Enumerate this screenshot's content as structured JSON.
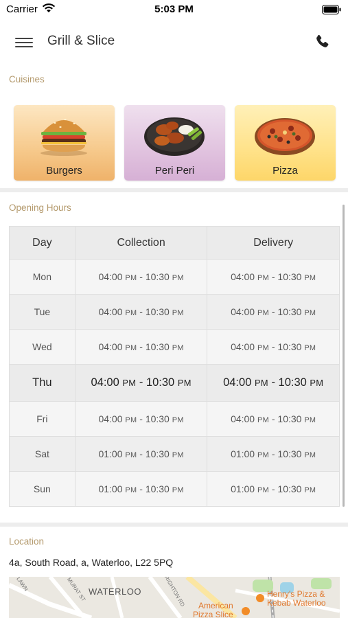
{
  "status_bar": {
    "carrier": "Carrier",
    "time": "5:03 PM"
  },
  "nav": {
    "title": "Grill & Slice",
    "menu_icon": "hamburger-menu-icon",
    "phone_icon": "phone-icon"
  },
  "cuisines": {
    "label": "Cuisines",
    "items": [
      {
        "name": "Burgers",
        "icon": "burger-image"
      },
      {
        "name": "Peri Peri",
        "icon": "chicken-wings-image"
      },
      {
        "name": "Pizza",
        "icon": "pizza-image"
      }
    ]
  },
  "opening_hours": {
    "label": "Opening Hours",
    "headers": [
      "Day",
      "Collection",
      "Delivery"
    ],
    "rows": [
      {
        "day": "Mon",
        "collection": {
          "open": "04:00",
          "open_ampm": "PM",
          "close": "10:30",
          "close_ampm": "PM"
        },
        "delivery": {
          "open": "04:00",
          "open_ampm": "PM",
          "close": "10:30",
          "close_ampm": "PM"
        }
      },
      {
        "day": "Tue",
        "collection": {
          "open": "04:00",
          "open_ampm": "PM",
          "close": "10:30",
          "close_ampm": "PM"
        },
        "delivery": {
          "open": "04:00",
          "open_ampm": "PM",
          "close": "10:30",
          "close_ampm": "PM"
        }
      },
      {
        "day": "Wed",
        "collection": {
          "open": "04:00",
          "open_ampm": "PM",
          "close": "10:30",
          "close_ampm": "PM"
        },
        "delivery": {
          "open": "04:00",
          "open_ampm": "PM",
          "close": "10:30",
          "close_ampm": "PM"
        }
      },
      {
        "day": "Thu",
        "collection": {
          "open": "04:00",
          "open_ampm": "PM",
          "close": "10:30",
          "close_ampm": "PM"
        },
        "delivery": {
          "open": "04:00",
          "open_ampm": "PM",
          "close": "10:30",
          "close_ampm": "PM"
        }
      },
      {
        "day": "Fri",
        "collection": {
          "open": "04:00",
          "open_ampm": "PM",
          "close": "10:30",
          "close_ampm": "PM"
        },
        "delivery": {
          "open": "04:00",
          "open_ampm": "PM",
          "close": "10:30",
          "close_ampm": "PM"
        }
      },
      {
        "day": "Sat",
        "collection": {
          "open": "01:00",
          "open_ampm": "PM",
          "close": "10:30",
          "close_ampm": "PM"
        },
        "delivery": {
          "open": "01:00",
          "open_ampm": "PM",
          "close": "10:30",
          "close_ampm": "PM"
        }
      },
      {
        "day": "Sun",
        "collection": {
          "open": "01:00",
          "open_ampm": "PM",
          "close": "10:30",
          "close_ampm": "PM"
        },
        "delivery": {
          "open": "01:00",
          "open_ampm": "PM",
          "close": "10:30",
          "close_ampm": "PM"
        }
      }
    ]
  },
  "location": {
    "label": "Location",
    "address": "4a, South Road, a, Waterloo, L22 5PQ",
    "map": {
      "area_label": "WATERLOO",
      "streets": [
        "LAWN",
        "MURAT ST",
        "BRIGHTON RD"
      ],
      "places": [
        "Henry's Pizza &",
        "Kebab Waterloo",
        "American",
        "Pizza Slice"
      ]
    }
  },
  "colors": {
    "section_label": "#b49a6d",
    "map_pin": "#f28c28",
    "map_label": "#e0762a"
  }
}
